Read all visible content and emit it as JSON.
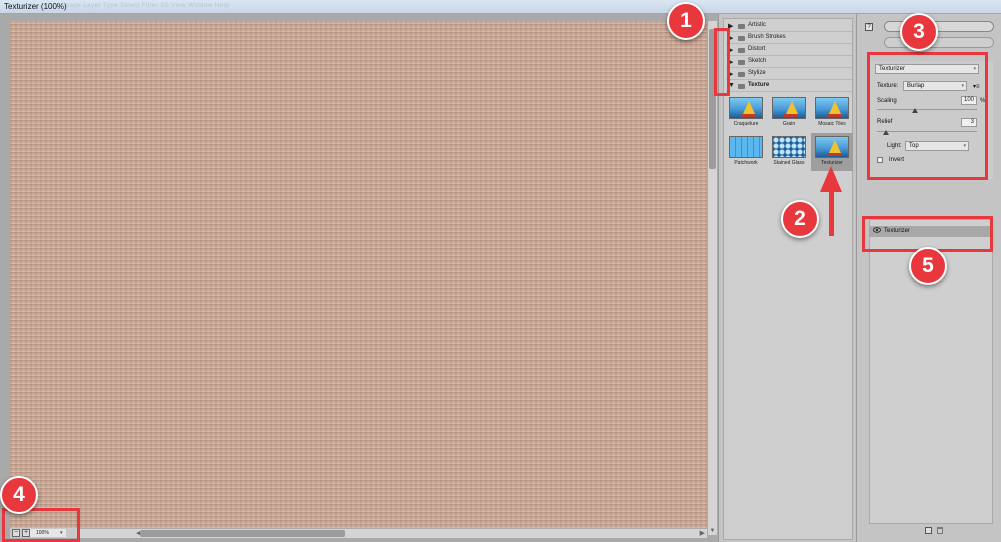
{
  "window": {
    "title": "Texturizer (100%)",
    "ghost_menu": "Image  Layer  Type  Select  Filter  3D  View  Window  Help"
  },
  "preview": {
    "zoom_out": "−",
    "zoom_in": "+",
    "zoom_value": "100%",
    "zoom_dropdown": "▾",
    "canvas_color": "#c9a795"
  },
  "gallery": {
    "categories": [
      {
        "label": "Artistic",
        "expanded": false
      },
      {
        "label": "Brush Strokes",
        "expanded": false
      },
      {
        "label": "Distort",
        "expanded": false
      },
      {
        "label": "Sketch",
        "expanded": false
      },
      {
        "label": "Stylize",
        "expanded": false
      },
      {
        "label": "Texture",
        "expanded": true
      }
    ],
    "collapsed_glyph": "▶",
    "expanded_glyph": "▼",
    "thumbnails": [
      {
        "label": "Craquelure"
      },
      {
        "label": "Grain"
      },
      {
        "label": "Mosaic Tiles"
      },
      {
        "label": "Patchwork"
      },
      {
        "label": "Stained Glass"
      },
      {
        "label": "Texturizer",
        "selected": true
      }
    ]
  },
  "settings": {
    "help_glyph": "?",
    "filter_select": "Texturizer",
    "texture_label": "Texture:",
    "texture_value": "Burlap",
    "texture_menu_glyph": "▾≡",
    "scaling_label": "Scaling",
    "scaling_value": "100",
    "scaling_unit": "%",
    "relief_label": "Relief",
    "relief_value": "3",
    "light_label": "Light:",
    "light_value": "Top",
    "invert_label": "Invert",
    "invert_checked": false,
    "dropdown_glyph": "▾"
  },
  "layers": {
    "items": [
      {
        "name": "Texturizer",
        "visible": true
      }
    ],
    "eye_glyph": "👁"
  },
  "annotations": {
    "labels": [
      "1",
      "2",
      "3",
      "4",
      "5"
    ],
    "color": "#e8383d"
  }
}
